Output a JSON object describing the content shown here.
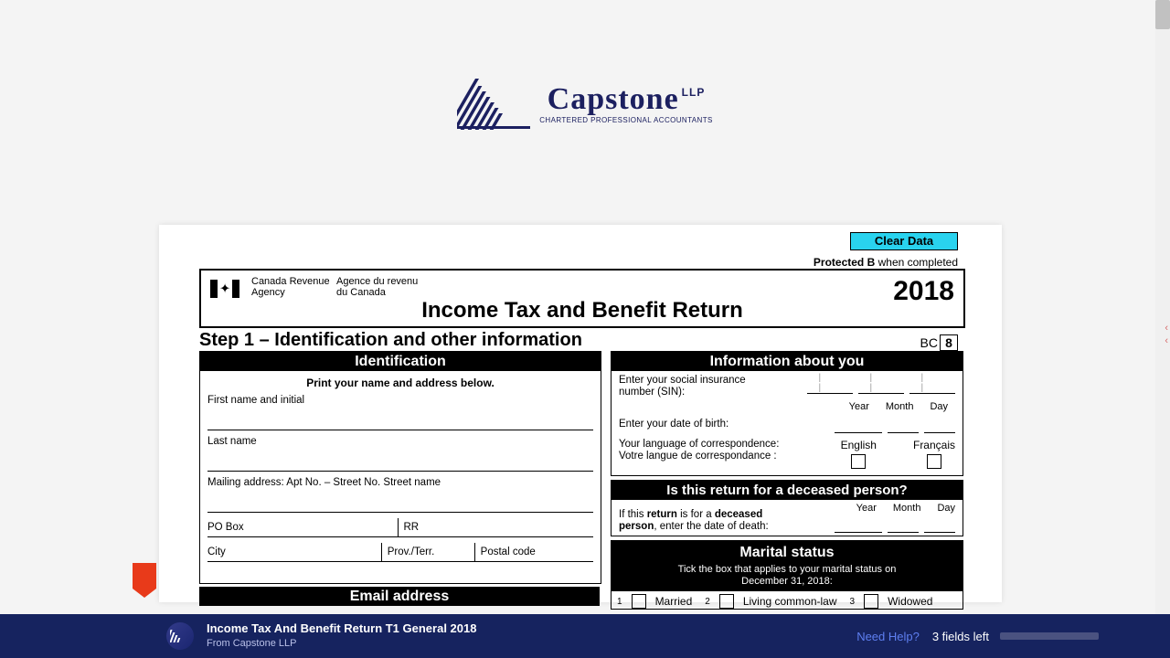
{
  "logo": {
    "brand": "Capstone",
    "llp": "LLP",
    "tagline": "CHARTERED PROFESSIONAL ACCOUNTANTS"
  },
  "doc": {
    "clear": "Clear Data",
    "protected_b": "Protected B",
    "when_completed": "when completed",
    "cra_en_1": "Canada Revenue",
    "cra_en_2": "Agency",
    "cra_fr_1": "Agence du revenu",
    "cra_fr_2": "du Canada",
    "year": "2018",
    "title": "Income Tax and Benefit Return",
    "step1": "Step 1 – Identification and other information",
    "prov": "BC",
    "prov_code": "8",
    "ident": {
      "heading": "Identification",
      "instr": "Print your name and address below.",
      "first": "First name and initial",
      "last": "Last name",
      "mail": "Mailing address: Apt No. – Street No. Street name",
      "po": "PO Box",
      "rr": "RR",
      "city": "City",
      "provterr": "Prov./Terr.",
      "postal": "Postal code"
    },
    "email": {
      "heading": "Email address"
    },
    "info": {
      "heading": "Information about you",
      "sin1": "Enter your social insurance",
      "sin2": "number (SIN):",
      "dob": "Enter your date of birth:",
      "yr": "Year",
      "mo": "Month",
      "dy": "Day",
      "lang1": "Your language of correspondence:",
      "lang2": "Votre langue de correspondance :",
      "en": "English",
      "fr": "Français"
    },
    "deceased": {
      "heading": "Is this return for a deceased person?",
      "t1": "If this ",
      "t2": "return",
      "t3": " is for a ",
      "t4": "deceased",
      "t5": "person",
      "t6": ", enter the date of death:",
      "yr": "Year",
      "mo": "Month",
      "dy": "Day"
    },
    "marital": {
      "heading": "Marital status",
      "sub1": "Tick the box that applies to your marital status on",
      "sub2": "December 31, 2018:",
      "o1": "Married",
      "o2": "Living common-law",
      "o3": "Widowed"
    }
  },
  "bottombar": {
    "title": "Income Tax And Benefit Return T1 General 2018",
    "from": "From Capstone LLP",
    "help": "Need Help?",
    "fields": "3 fields left"
  }
}
